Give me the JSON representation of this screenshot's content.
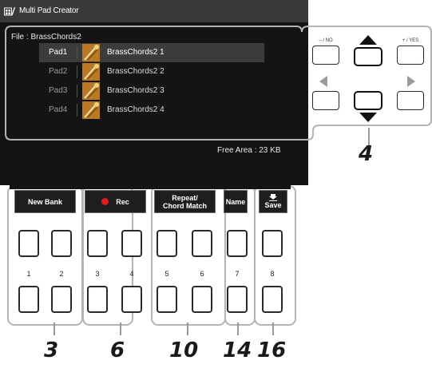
{
  "screen": {
    "title": "Multi Pad Creator",
    "file_label": "File : BrassChords2",
    "pads": [
      {
        "pad": "Pad1",
        "file": "BrassChords2 1",
        "selected": true
      },
      {
        "pad": "Pad2",
        "file": "BrassChords2 2",
        "selected": false
      },
      {
        "pad": "Pad3",
        "file": "BrassChords2 3",
        "selected": false
      },
      {
        "pad": "Pad4",
        "file": "BrassChords2 4",
        "selected": false
      }
    ],
    "free_area": "Free Area : 23 KB"
  },
  "right_panel": {
    "no_label": "– / NO",
    "yes_label": "+ / YES"
  },
  "tabs": {
    "new_bank": "New Bank",
    "rec": "Rec",
    "repeat_line1": "Repeat/",
    "repeat_line2": "Chord Match",
    "name": "Name",
    "save": "Save"
  },
  "pad_numbers": [
    "1",
    "2",
    "3",
    "4",
    "5",
    "6",
    "7",
    "8"
  ],
  "callouts": {
    "c4": "4",
    "c3": "3",
    "c6": "6",
    "c10": "10",
    "c14": "14",
    "c16": "16"
  },
  "colors": {
    "screen_bg": "#141414",
    "rec_dot": "#e01919",
    "outline": "#b4b4b4"
  }
}
